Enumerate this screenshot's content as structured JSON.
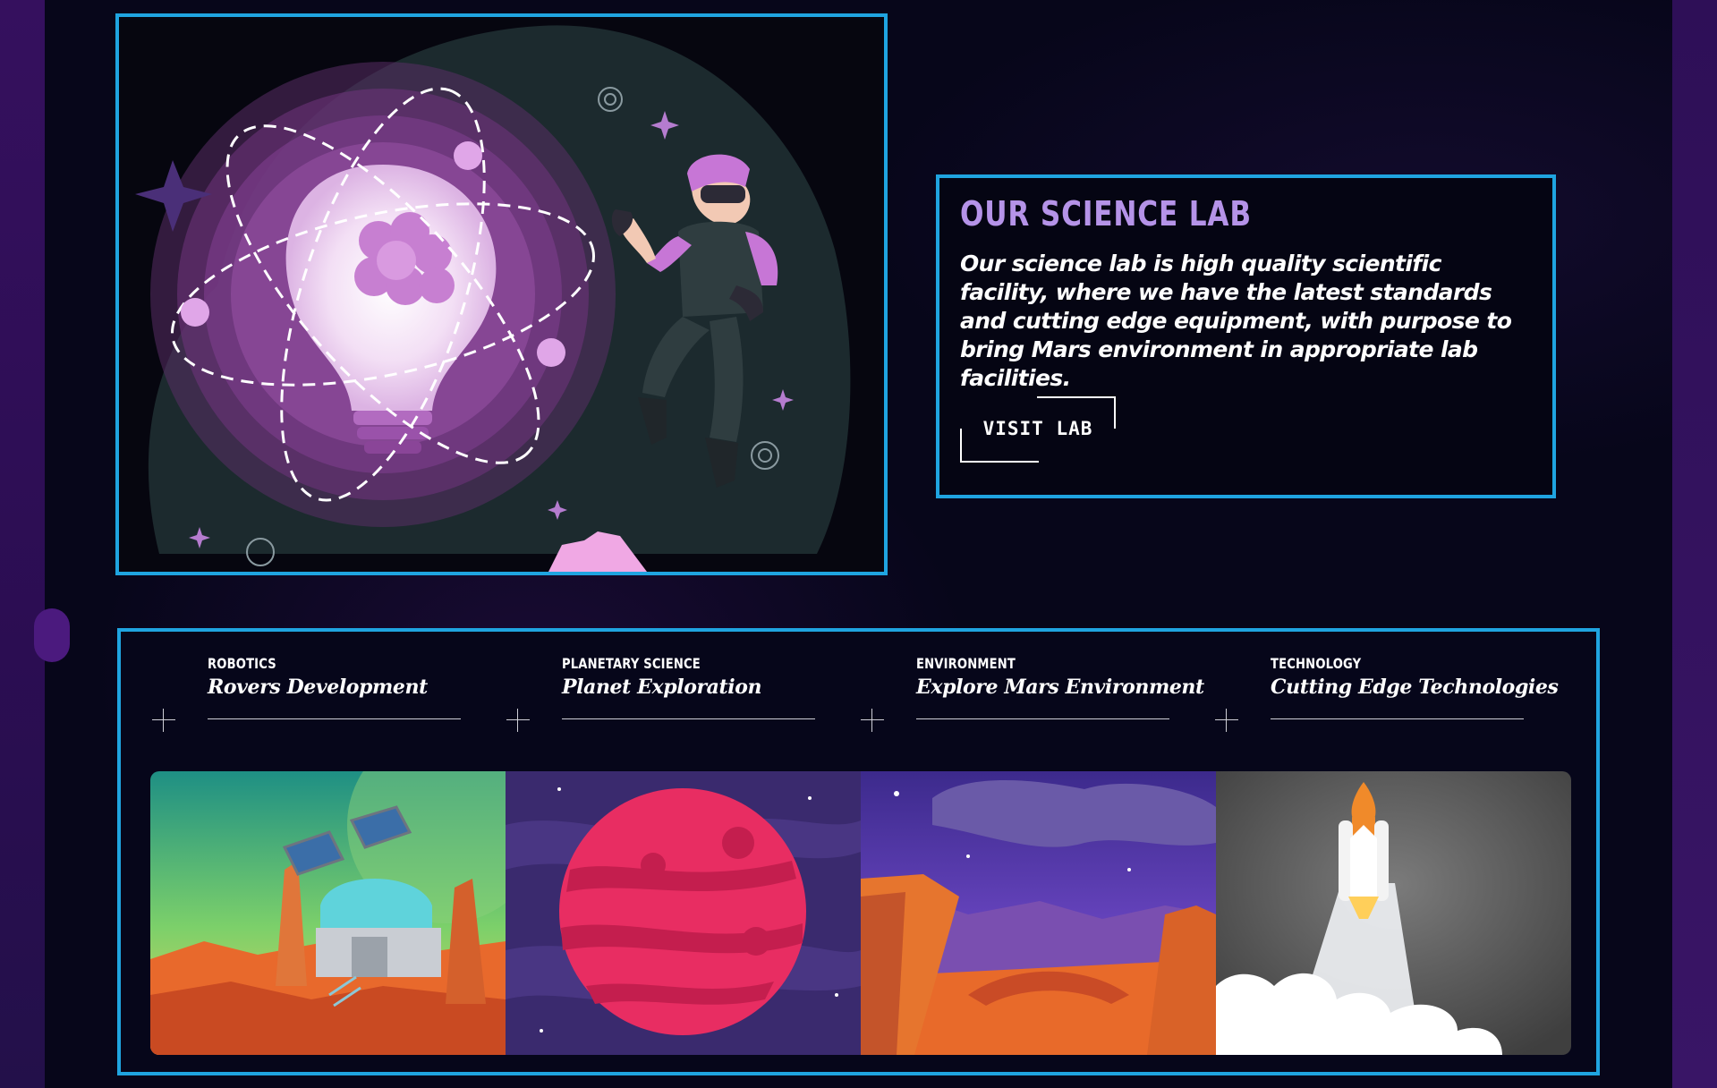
{
  "lab": {
    "title": "OUR SCIENCE LAB",
    "description": "Our science lab is high quality scientific facility, where we have the latest standards and cutting edge equipment, with purpose to bring Mars environment in appropriate lab facilities.",
    "button_label": "VISIT LAB"
  },
  "categories": [
    {
      "tag": "ROBOTICS",
      "title": "Rovers Development"
    },
    {
      "tag": "PLANETARY SCIENCE",
      "title": "Planet Exploration"
    },
    {
      "tag": "ENVIRONMENT",
      "title": "Explore Mars Environment"
    },
    {
      "tag": "TECHNOLOGY",
      "title": "Cutting Edge Technologies"
    }
  ],
  "colors": {
    "frame_border": "#1fa4e0",
    "title_accent": "#b593e8",
    "page_background": "#07061a"
  }
}
